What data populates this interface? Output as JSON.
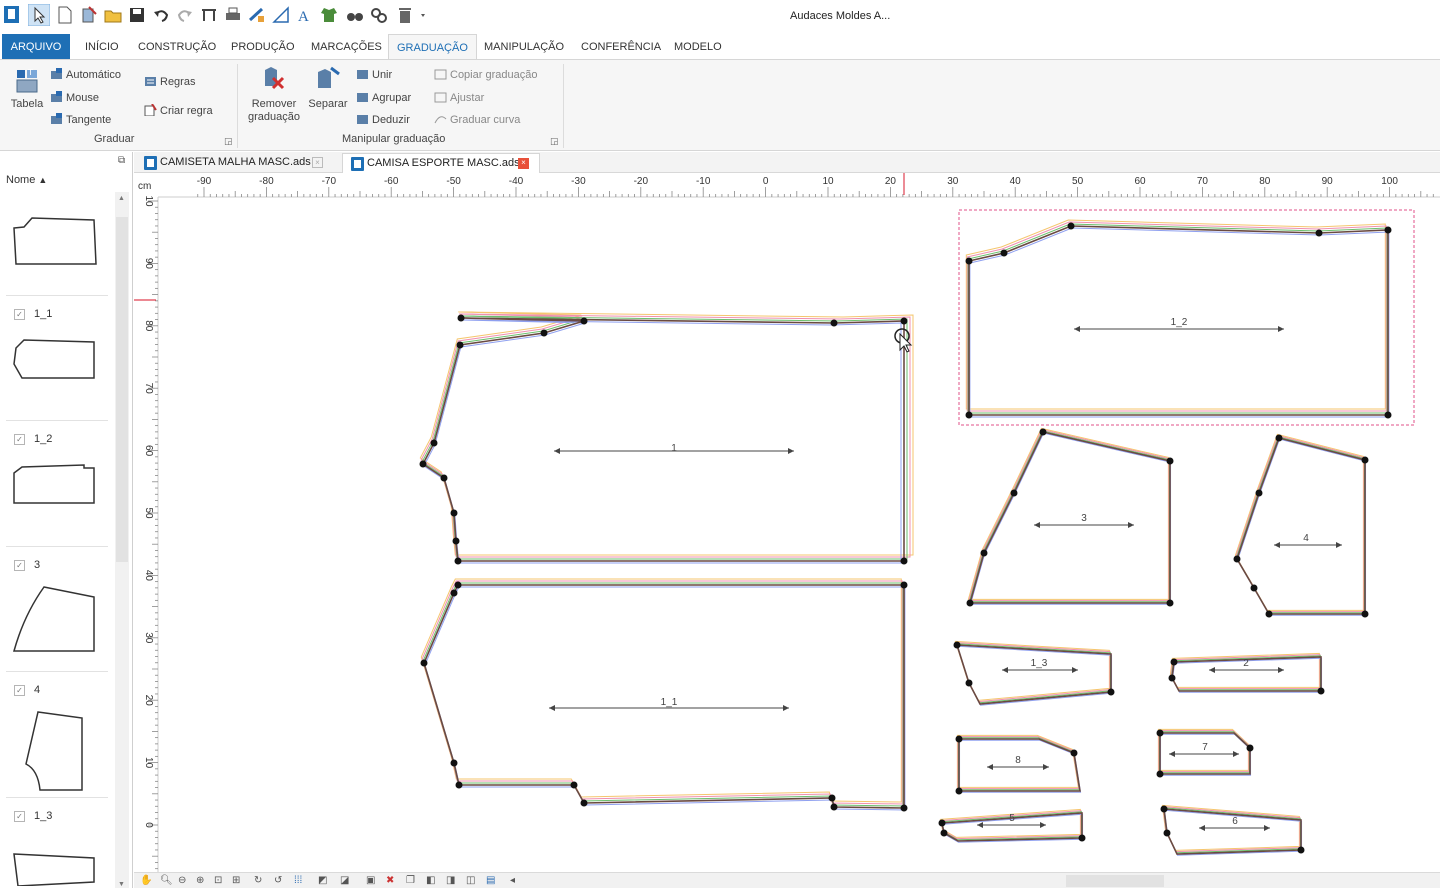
{
  "window": {
    "title": "Audaces Moldes A..."
  },
  "ribbon": {
    "tabs": [
      "ARQUIVO",
      "INÍCIO",
      "CONSTRUÇÃO",
      "PRODUÇÃO",
      "MARCAÇÕES",
      "GRADUAÇÃO",
      "MANIPULAÇÃO",
      "CONFERÊNCIA",
      "MODELO"
    ],
    "active_tab": "GRADUAÇÃO",
    "graduar": {
      "group_label": "Graduar",
      "tabela": "Tabela",
      "automatico": "Automático",
      "mouse": "Mouse",
      "tangente": "Tangente",
      "regras": "Regras",
      "criar_regra": "Criar regra"
    },
    "manipular": {
      "group_label": "Manipular graduação",
      "remover_1": "Remover",
      "remover_2": "graduação",
      "separar": "Separar",
      "unir": "Unir",
      "agrupar": "Agrupar",
      "deduzir": "Deduzir",
      "copiar": "Copiar graduação",
      "ajustar": "Ajustar",
      "graduar_curva": "Graduar curva"
    }
  },
  "left_panel": {
    "header": "Nome",
    "items": [
      {
        "label": "1_1",
        "checked": true
      },
      {
        "label": "1_2",
        "checked": true
      },
      {
        "label": "3",
        "checked": true
      },
      {
        "label": "4",
        "checked": true
      },
      {
        "label": "1_3",
        "checked": true
      }
    ]
  },
  "doc_tabs": [
    {
      "label": "CAMISETA MALHA MASC.ads",
      "active": false
    },
    {
      "label": "CAMISA ESPORTE MASC.ads",
      "active": true
    }
  ],
  "canvas": {
    "unit": "cm",
    "ruler_x": [
      "-90",
      "-80",
      "-70",
      "-60",
      "-50",
      "-40",
      "-30",
      "-20",
      "-10",
      "0",
      "10",
      "20",
      "30",
      "40",
      "50",
      "60",
      "70",
      "80",
      "90",
      "100"
    ],
    "ruler_y": [
      "10",
      "90",
      "80",
      "70",
      "60",
      "50",
      "40",
      "30",
      "20",
      "10",
      "0"
    ],
    "piece_labels": [
      "1",
      "1_1",
      "1_2",
      "3",
      "4",
      "1_3",
      "2",
      "8",
      "7",
      "5",
      "6"
    ],
    "size_colors": [
      "#f5c66e",
      "#f08fb0",
      "#6cbf6c",
      "#8fa0f0"
    ]
  }
}
